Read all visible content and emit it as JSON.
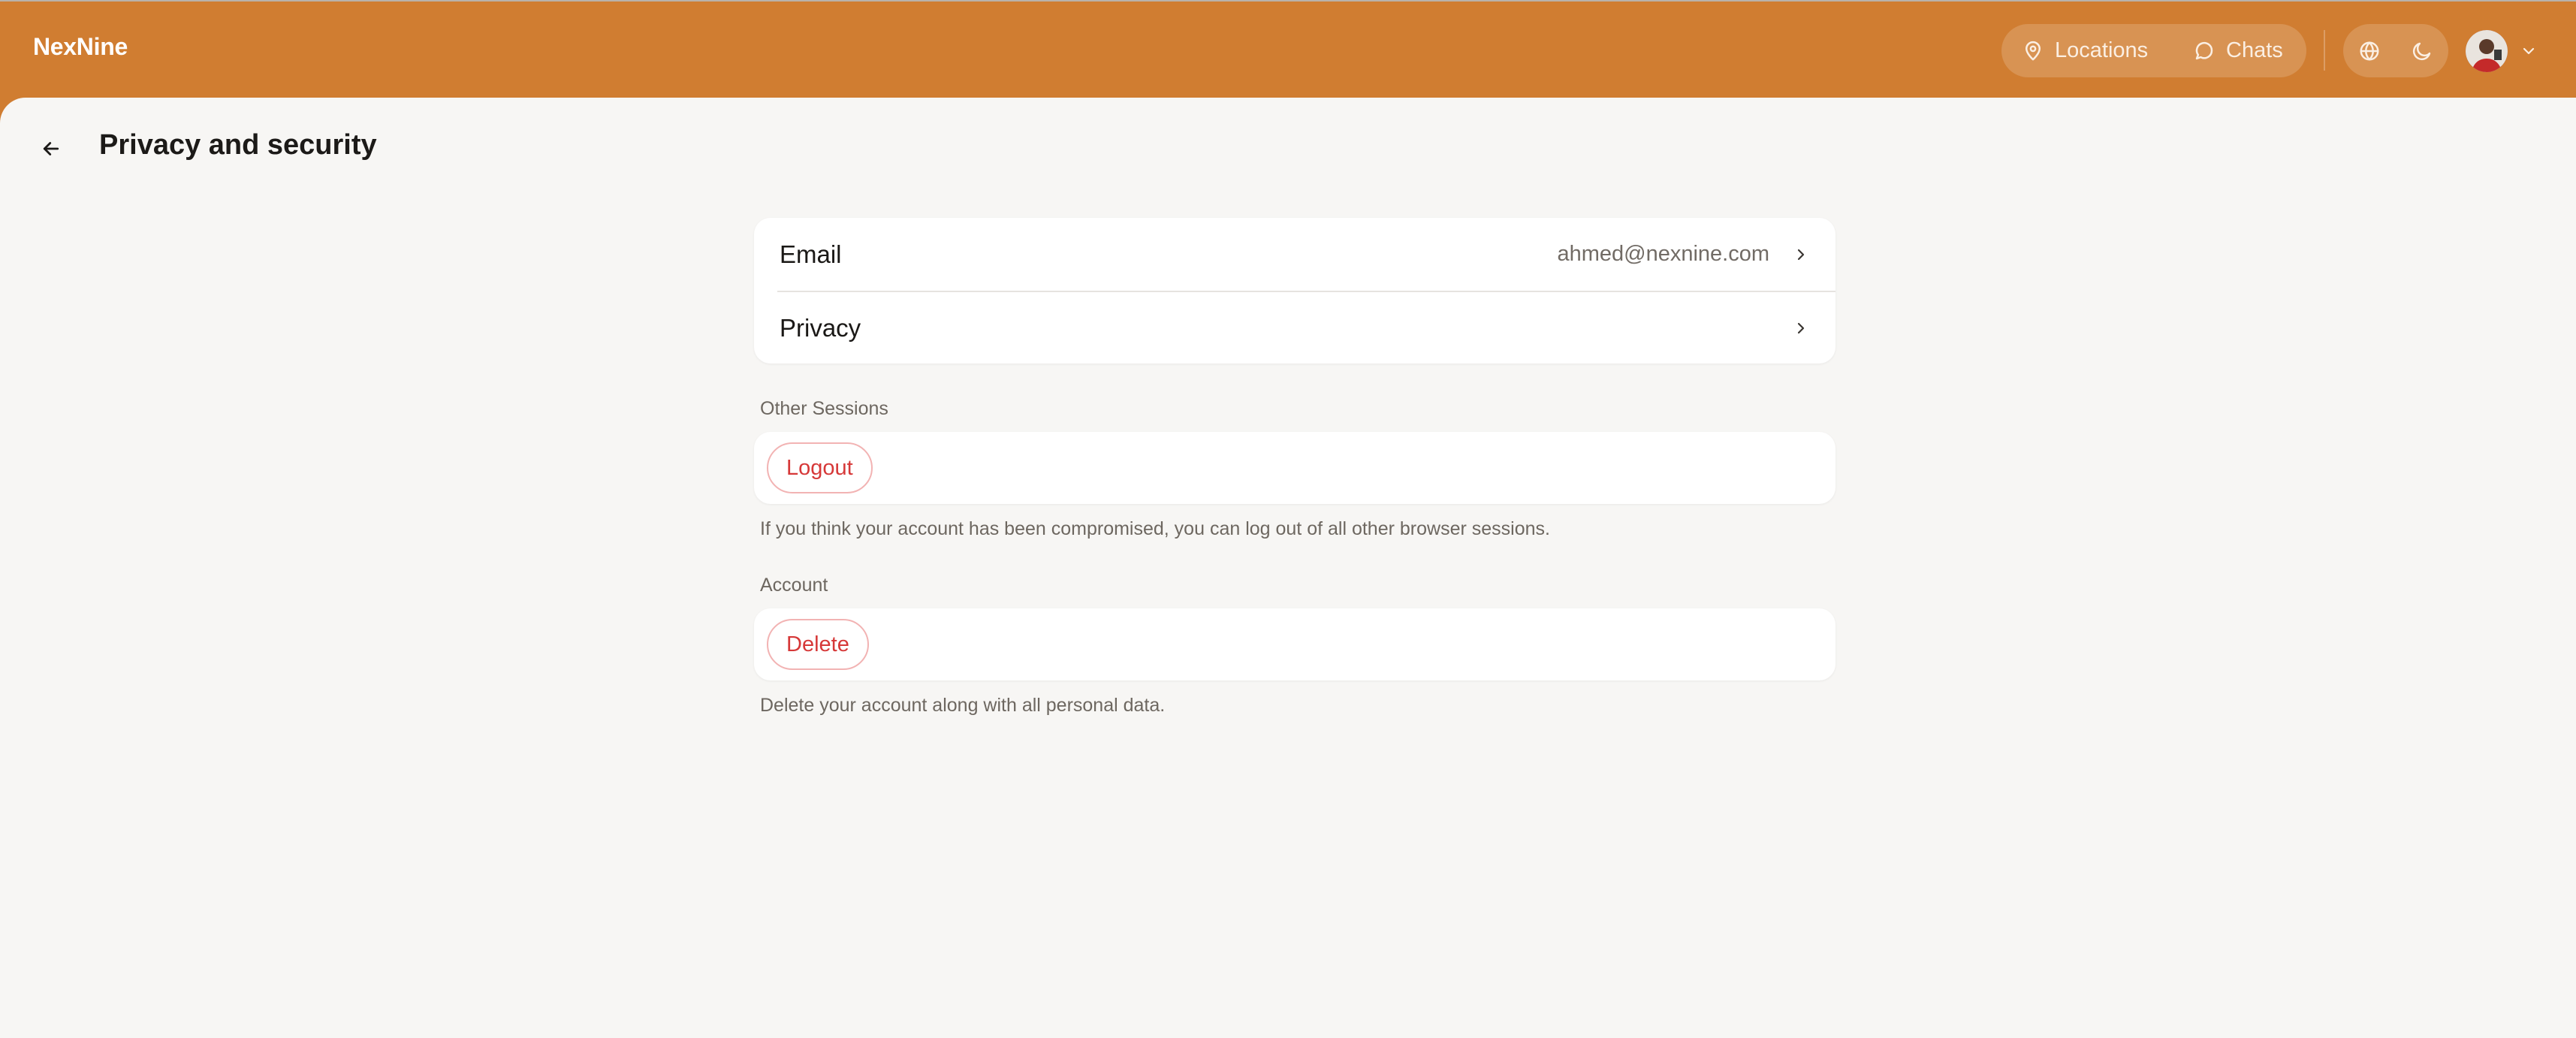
{
  "app": {
    "brand": "NexNine",
    "accent_color": "#d07d31"
  },
  "topbar": {
    "nav": [
      {
        "label": "Locations",
        "icon": "map-pin-icon"
      },
      {
        "label": "Chats",
        "icon": "chat-bubble-icon"
      }
    ],
    "tools": [
      {
        "icon": "globe-icon"
      },
      {
        "icon": "moon-icon"
      }
    ],
    "user": {
      "avatar": "avatar",
      "menu_icon": "chevron-down-icon"
    }
  },
  "page": {
    "title": "Privacy and security",
    "back_icon": "arrow-left-icon"
  },
  "settings": {
    "rows": [
      {
        "label": "Email",
        "value": "ahmed@nexnine.com"
      },
      {
        "label": "Privacy",
        "value": ""
      }
    ]
  },
  "sessions": {
    "heading": "Other Sessions",
    "button": "Logout",
    "description": "If you think your account has been compromised, you can log out of all other browser sessions.",
    "danger_color": "#d63838"
  },
  "account": {
    "heading": "Account",
    "button": "Delete",
    "description": "Delete your account along with all personal data."
  }
}
